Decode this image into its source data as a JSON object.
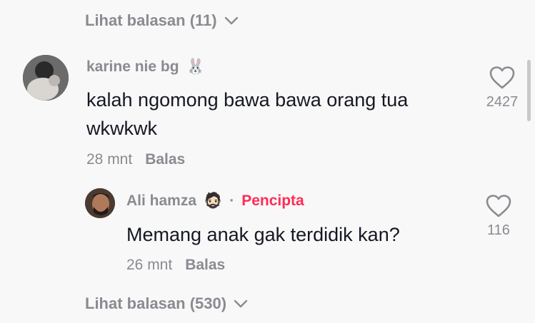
{
  "top_view_replies": {
    "label": "Lihat balasan (11)"
  },
  "comment1": {
    "username": "karine nie bg",
    "username_emoji": "🐰",
    "text_line1": "kalah ngomong bawa bawa orang tua",
    "text_line2": "wkwkwk",
    "time": "28 mnt",
    "reply_label": "Balas",
    "likes": "2427"
  },
  "comment2": {
    "username": "Ali hamza",
    "username_emoji": "🧔🏻",
    "separator": "·",
    "creator_label": "Pencipta",
    "text": "Memang anak gak terdidik kan?",
    "time": "26 mnt",
    "reply_label": "Balas",
    "likes": "116"
  },
  "bottom_view_replies": {
    "label": "Lihat balasan (530)"
  },
  "colors": {
    "muted": "#8a8b91",
    "text": "#161823",
    "creator": "#fe2c55",
    "background": "#f8f8f8"
  },
  "icons": [
    "heart-outline-icon",
    "chevron-down-icon"
  ]
}
